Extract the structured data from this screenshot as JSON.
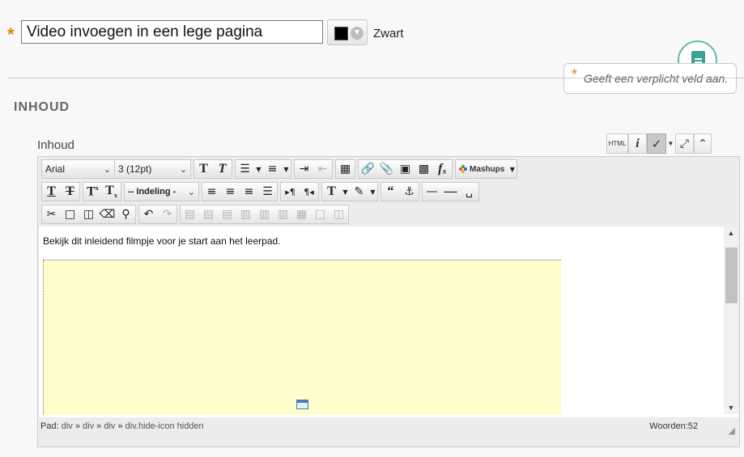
{
  "title_field": {
    "value": "Video invoegen in een lege pagina",
    "required_mark": "*"
  },
  "color_picker": {
    "color": "#000000",
    "label": "Zwart"
  },
  "required_note": {
    "star": "*",
    "text": "Geeft een verplicht veld aan."
  },
  "section": {
    "title": "INHOUD"
  },
  "content_field": {
    "label": "Inhoud"
  },
  "top_tools": {
    "html_label": "HTML",
    "info_label": "i"
  },
  "toolbar": {
    "font_family": "Arial",
    "font_size": "3 (12pt)",
    "format": "-- Indeling -",
    "mashups_label": "Mashups"
  },
  "editor": {
    "body_text": "Bekijk dit inleidend filmpje voor je start aan het leerpad.",
    "video_placeholder_color": "#fffdcc"
  },
  "status": {
    "path_label": "Pad:",
    "path_items": [
      "div",
      "div",
      "div",
      "div.hide-icon hidden"
    ],
    "path_separator": "»",
    "word_count": "Woorden:52"
  },
  "colors": {
    "required_star": "#e0830f",
    "help_accent": "#38a394"
  }
}
